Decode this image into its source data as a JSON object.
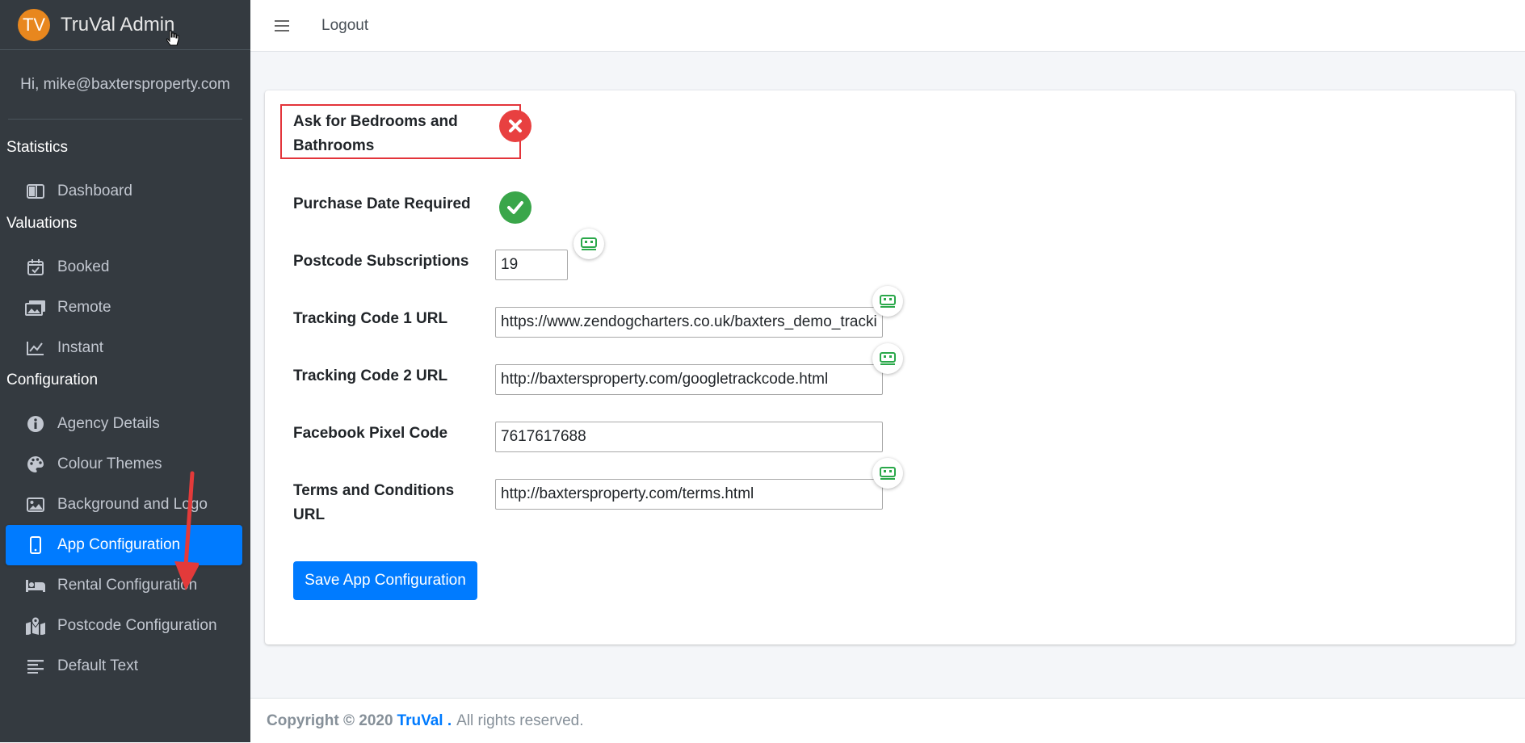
{
  "sidebar": {
    "brand_initials": "TV",
    "brand_name": "TruVal Admin",
    "greeting": "Hi, mike@baxtersproperty.com",
    "sections": {
      "statistics": "Statistics",
      "valuations": "Valuations",
      "configuration": "Configuration"
    },
    "items": {
      "dashboard": "Dashboard",
      "booked": "Booked",
      "remote": "Remote",
      "instant": "Instant",
      "agency_details": "Agency Details",
      "colour_themes": "Colour Themes",
      "background_logo": "Background and Logo",
      "app_configuration": "App Configuration",
      "rental_configuration": "Rental Configuration",
      "postcode_configuration": "Postcode Configuration",
      "default_text": "Default Text"
    }
  },
  "topnav": {
    "logout": "Logout"
  },
  "form": {
    "ask_bed_bath_label": "Ask for Bedrooms and Bathrooms",
    "ask_bed_bath_value": "no",
    "purchase_date_label": "Purchase Date Required",
    "purchase_date_value": "yes",
    "postcode_subs_label": "Postcode Subscriptions",
    "postcode_subs_value": "19",
    "tracking1_label": "Tracking Code 1 URL",
    "tracking1_value": "https://www.zendogcharters.co.uk/baxters_demo_tracking",
    "tracking2_label": "Tracking Code 2 URL",
    "tracking2_value": "http://baxtersproperty.com/googletrackcode.html",
    "fb_pixel_label": "Facebook Pixel Code",
    "fb_pixel_value": "7617617688",
    "terms_label": "Terms and Conditions URL",
    "terms_value": "http://baxtersproperty.com/terms.html",
    "save_label": "Save App Configuration"
  },
  "footer": {
    "copyright": "Copyright © 2020",
    "brand": "TruVal .",
    "rights": "All rights reserved."
  },
  "colors": {
    "sidebar_bg": "#343a40",
    "accent": "#007bff",
    "error": "#e84040",
    "success": "#3aa64a",
    "brand_logo": "#e8871e"
  }
}
